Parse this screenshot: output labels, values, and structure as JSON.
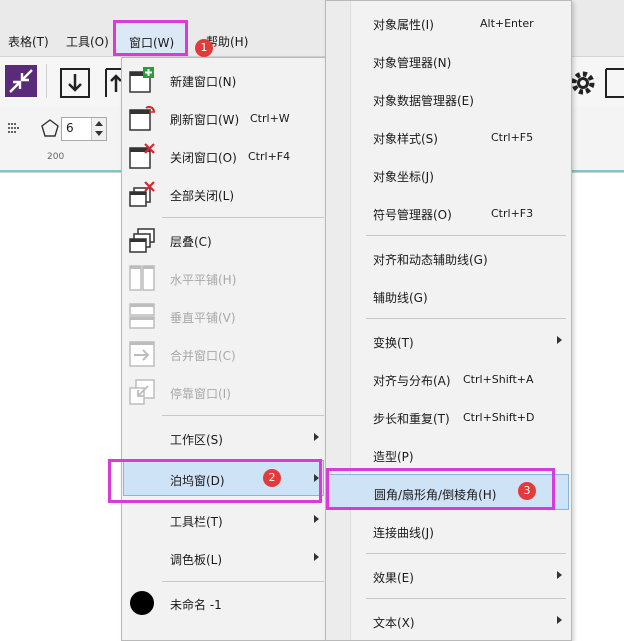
{
  "menubar": {
    "items": [
      {
        "label": "表格(T)"
      },
      {
        "label": "工具(O)"
      },
      {
        "label": "窗口(W)"
      },
      {
        "label": "帮助(H)"
      }
    ]
  },
  "ruler": {
    "tick_label": "200"
  },
  "prop_bar": {
    "sides_value": "6"
  },
  "window_menu": {
    "items": [
      {
        "label": "新建窗口(N)",
        "shortcut": ""
      },
      {
        "label": "刷新窗口(W)",
        "shortcut": "Ctrl+W"
      },
      {
        "label": "关闭窗口(O)",
        "shortcut": "Ctrl+F4"
      },
      {
        "label": "全部关闭(L)",
        "shortcut": ""
      },
      {
        "label": "层叠(C)",
        "shortcut": ""
      },
      {
        "label": "水平平铺(H)",
        "shortcut": ""
      },
      {
        "label": "垂直平铺(V)",
        "shortcut": ""
      },
      {
        "label": "合并窗口(C)",
        "shortcut": ""
      },
      {
        "label": "停靠窗口(I)",
        "shortcut": ""
      },
      {
        "label": "工作区(S)",
        "shortcut": ""
      },
      {
        "label": "泊坞窗(D)",
        "shortcut": ""
      },
      {
        "label": "工具栏(T)",
        "shortcut": ""
      },
      {
        "label": "调色板(L)",
        "shortcut": ""
      },
      {
        "label": "未命名 -1",
        "shortcut": ""
      }
    ]
  },
  "docker_menu": {
    "items": [
      {
        "label": "对象属性(I)",
        "shortcut": "Alt+Enter"
      },
      {
        "label": "对象管理器(N)",
        "shortcut": ""
      },
      {
        "label": "对象数据管理器(E)",
        "shortcut": ""
      },
      {
        "label": "对象样式(S)",
        "shortcut": "Ctrl+F5"
      },
      {
        "label": "对象坐标(J)",
        "shortcut": ""
      },
      {
        "label": "符号管理器(O)",
        "shortcut": "Ctrl+F3"
      },
      {
        "label": "对齐和动态辅助线(G)",
        "shortcut": ""
      },
      {
        "label": "辅助线(G)",
        "shortcut": ""
      },
      {
        "label": "变换(T)",
        "shortcut": ""
      },
      {
        "label": "对齐与分布(A)",
        "shortcut": "Ctrl+Shift+A"
      },
      {
        "label": "步长和重复(T)",
        "shortcut": "Ctrl+Shift+D"
      },
      {
        "label": "造型(P)",
        "shortcut": ""
      },
      {
        "label": "圆角/扇形角/倒棱角(H)",
        "shortcut": ""
      },
      {
        "label": "连接曲线(J)",
        "shortcut": ""
      },
      {
        "label": "效果(E)",
        "shortcut": ""
      },
      {
        "label": "文本(X)",
        "shortcut": ""
      }
    ]
  },
  "steps": {
    "one": "1",
    "two": "2",
    "three": "3"
  },
  "colors": {
    "highlight_border": "#d83bd8",
    "badge": "#e23b3b",
    "hover": "#cfe3f7"
  }
}
